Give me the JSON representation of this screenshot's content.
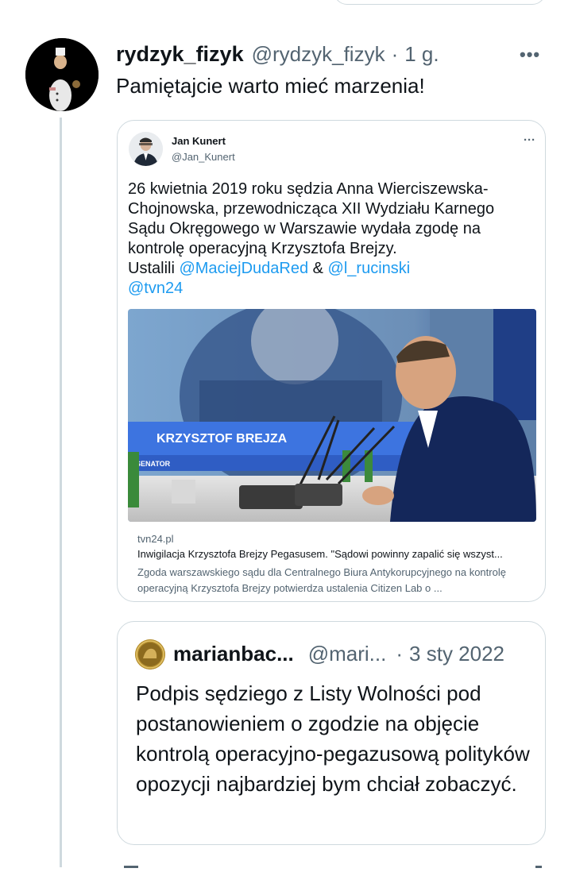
{
  "post": {
    "name": "rydzyk_fizyk",
    "handle": "@rydzyk_fizyk",
    "separator": "·",
    "time": "1 g.",
    "text": "Pamiętajcie warto mieć marzenia!",
    "more_icon": "more-horizontal-icon"
  },
  "quoted_tweet": {
    "name": "Jan Kunert",
    "handle": "@Jan_Kunert",
    "text_plain": "26 kwietnia 2019 roku sędzia Anna Wierciszewska-Chojnowska, przewodnicząca XII Wydziału Karnego Sądu Okręgowego w Warszawie wydała zgodę na kontrolę operacyjną Krzysztofa Brejzy.",
    "text_prefix": "Ustalili",
    "mention1": "@MaciejDudaRed",
    "amp": "&",
    "mention2": "@l_rucinski",
    "mention3": "@tvn24",
    "image_caption_name": "KRZYSZTOF BREJZA",
    "image_caption_role": "SENATOR",
    "link_card": {
      "domain": "tvn24.pl",
      "title": "Inwigilacja Krzysztofa Brejzy Pegasusem. \"Sądowi powinny zapalić się wszyst...",
      "description": "Zgoda warszawskiego sądu dla Centralnego Biura Antykorupcyjnego na kontrolę operacyjną Krzysztofa Brejzy potwierdza ustalenia Citizen Lab o ..."
    }
  },
  "quoted_reply": {
    "name": "marianbac...",
    "handle": "@mari...",
    "separator": "·",
    "date": "3 sty 2022",
    "text": "Podpis sędziego z Listy Wolności pod postanowieniem o zgodzie na objęcie kontrolą operacyjno-pegazusową polityków opozycji najbardziej bym chciał zobaczyć."
  },
  "colors": {
    "accent": "#1d9bf0",
    "secondary_text": "#536471",
    "border": "#cfd9de"
  }
}
